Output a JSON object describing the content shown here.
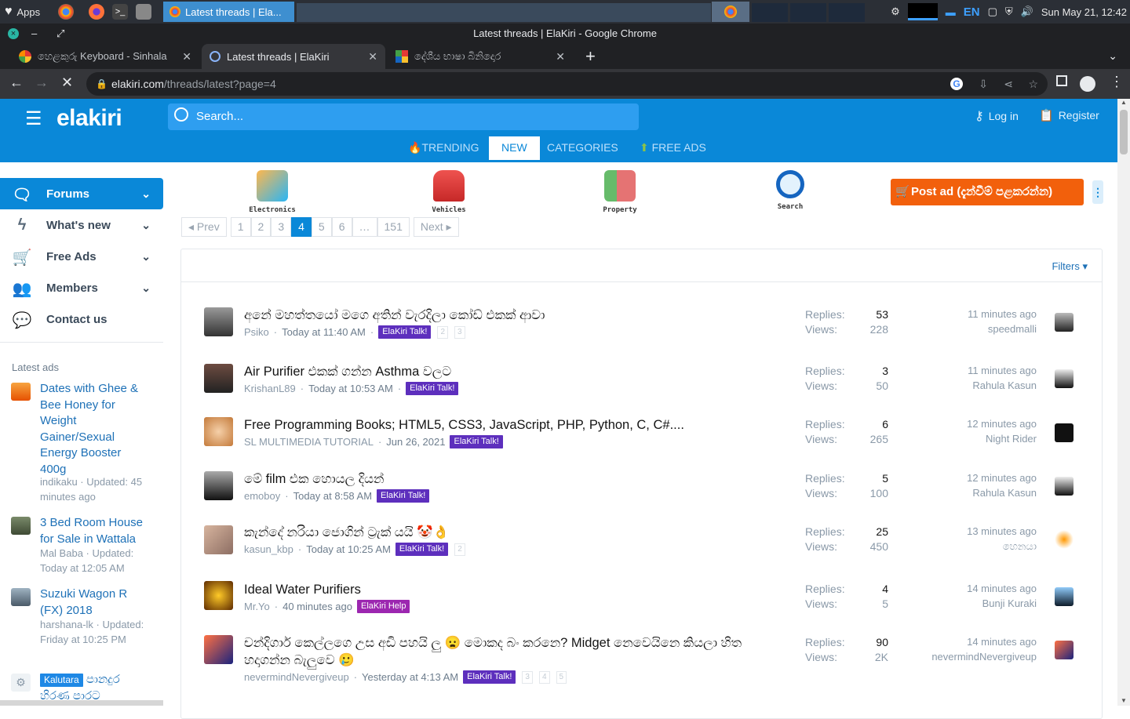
{
  "os": {
    "apps_label": "Apps",
    "active_window": "Latest threads | Ela...",
    "lang": "EN",
    "clock": "Sun May 21, 12:42"
  },
  "browser": {
    "window_title": "Latest threads | ElaKiri - Google Chrome",
    "tabs": [
      {
        "label": "හෙළකුරු Keyboard - Sinhala"
      },
      {
        "label": "Latest threads | ElaKiri"
      },
      {
        "label": "දේශීය භාෂා බිනිදොර"
      }
    ],
    "new_tab": "+",
    "url_host": "elakiri.com",
    "url_path": "/threads/latest?page=4"
  },
  "site": {
    "logo": "elakiri",
    "search_placeholder": "Search...",
    "login": "Log in",
    "register": "Register",
    "nav": {
      "trending": "TRENDING",
      "new": "NEW",
      "categories": "CATEGORIES",
      "free_ads": "FREE ADS"
    },
    "accent": "#0a88d8"
  },
  "sidebar": {
    "items": [
      {
        "label": "Forums"
      },
      {
        "label": "What's new"
      },
      {
        "label": "Free Ads"
      },
      {
        "label": "Members"
      },
      {
        "label": "Contact us"
      }
    ],
    "latest_ads_title": "Latest ads",
    "ads": [
      {
        "title": "Dates with Ghee & Bee Honey for Weight Gainer/Sexual Energy Booster 400g",
        "meta": "indikaku · Updated: 45 minutes ago"
      },
      {
        "title": "3 Bed Room House for Sale in Wattala",
        "meta": "Mal Baba · Updated: Today at 12:05 AM"
      },
      {
        "title": "Suzuki Wagon R (FX) 2018",
        "meta": "harshana-lk · Updated: Friday at 10:25 PM"
      },
      {
        "badge": "Kalutara",
        "title": "පානදුර හිරණ පාරට"
      }
    ]
  },
  "categories": [
    {
      "label": "Electronics"
    },
    {
      "label": "Vehicles"
    },
    {
      "label": "Property"
    },
    {
      "label": "Search"
    }
  ],
  "post_ad": "Post ad (දැන්වීම් පළකරන්න)",
  "pager": {
    "prev": "Prev",
    "pages": [
      "1",
      "2",
      "3",
      "4",
      "5",
      "6",
      "…",
      "151"
    ],
    "current": "4",
    "next": "Next"
  },
  "filters": "Filters",
  "labels": {
    "replies": "Replies:",
    "views": "Views:"
  },
  "threads": [
    {
      "title": "අනේ මහත්තයෝ මගෙ අතින් වැරදිලා කෝඩ් එකක් ආවා",
      "author": "Psiko",
      "date": "Today at 11:40 AM",
      "prefix": "ElaKiri Talk!",
      "pages": [
        "2",
        "3"
      ],
      "replies": "53",
      "views": "228",
      "last_time": "11 minutes ago",
      "last_user": "speedmalli"
    },
    {
      "title": "Air Purifier එකක් ගන්න Asthma වලට",
      "author": "KrishanL89",
      "date": "Today at 10:53 AM",
      "prefix": "ElaKiri Talk!",
      "pages": [],
      "replies": "3",
      "views": "50",
      "last_time": "11 minutes ago",
      "last_user": "Rahula Kasun"
    },
    {
      "title": "Free Programming Books; HTML5, CSS3, JavaScript, PHP, Python, C, C#....",
      "author": "SL MULTIMEDIA TUTORIAL",
      "date": "Jun 26, 2021",
      "prefix": "ElaKiri Talk!",
      "pages": [],
      "replies": "6",
      "views": "265",
      "last_time": "12 minutes ago",
      "last_user": "Night Rider"
    },
    {
      "title": "මේ film එක හොයල දියන්",
      "author": "emoboy",
      "date": "Today at 8:58 AM",
      "prefix": "ElaKiri Talk!",
      "pages": [],
      "replies": "5",
      "views": "100",
      "last_time": "12 minutes ago",
      "last_user": "Rahula Kasun"
    },
    {
      "title": "කැන්දේ නරියා ජොගින් ට්‍රැක් යයි 🤡👌",
      "author": "kasun_kbp",
      "date": "Today at 10:25 AM",
      "prefix": "ElaKiri Talk!",
      "pages": [
        "2"
      ],
      "replies": "25",
      "views": "450",
      "last_time": "13 minutes ago",
      "last_user": "හෙනයා"
    },
    {
      "title": "Ideal Water Purifiers",
      "author": "Mr.Yo",
      "date": "40 minutes ago",
      "prefix": "ElaKiri Help",
      "pages": [],
      "replies": "4",
      "views": "5",
      "last_time": "14 minutes ago",
      "last_user": "Bunji Kuraki"
    },
    {
      "title": "චන්දිගාර් කෙල්ලගෙ උස අඩි පහයි ලු 😦 මොකද බං කරනෙ? Midget නෙවෙයිනෙ කියලා හිත හදාගන්න බැලුවෙ 🥲",
      "author": "nevermindNevergiveup",
      "date": "Yesterday at 4:13 AM",
      "prefix": "ElaKiri Talk!",
      "pages": [
        "3",
        "4",
        "5"
      ],
      "replies": "90",
      "views": "2K",
      "last_time": "14 minutes ago",
      "last_user": "nevermindNevergiveup"
    }
  ]
}
